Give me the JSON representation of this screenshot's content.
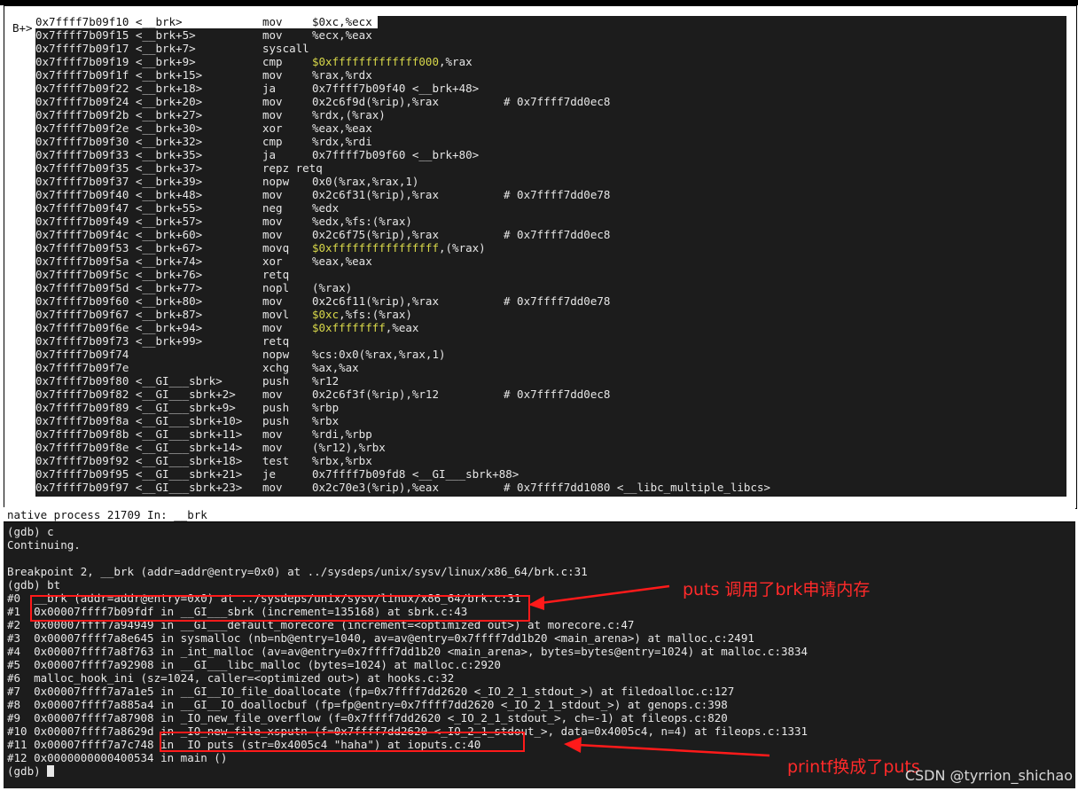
{
  "window": {
    "breakpoint_marker": "B+>",
    "status_line": "native process 21709 In: __brk"
  },
  "asm_lines": [
    {
      "addr": "0x7ffff7b09f10",
      "sym": "<__brk>",
      "op": "mov",
      "args": "$0xc,%ecx",
      "hl": false,
      "comment": ""
    },
    {
      "addr": "0x7ffff7b09f15",
      "sym": "<__brk+5>",
      "op": "mov",
      "args": "%ecx,%eax",
      "hl": false,
      "comment": ""
    },
    {
      "addr": "0x7ffff7b09f17",
      "sym": "<__brk+7>",
      "op": "syscall",
      "args": "",
      "hl": false,
      "comment": ""
    },
    {
      "addr": "0x7ffff7b09f19",
      "sym": "<__brk+9>",
      "op": "cmp",
      "args": "$0xfffffffffffff000",
      "args2": ",%rax",
      "hl": true,
      "comment": ""
    },
    {
      "addr": "0x7ffff7b09f1f",
      "sym": "<__brk+15>",
      "op": "mov",
      "args": "%rax,%rdx",
      "hl": false,
      "comment": ""
    },
    {
      "addr": "0x7ffff7b09f22",
      "sym": "<__brk+18>",
      "op": "ja",
      "args": "0x7ffff7b09f40 <__brk+48>",
      "hl": false,
      "comment": ""
    },
    {
      "addr": "0x7ffff7b09f24",
      "sym": "<__brk+20>",
      "op": "mov",
      "args": "0x2c6f9d(%rip),%rax",
      "hl": false,
      "comment": "# 0x7ffff7dd0ec8"
    },
    {
      "addr": "0x7ffff7b09f2b",
      "sym": "<__brk+27>",
      "op": "mov",
      "args": "%rdx,(%rax)",
      "hl": false,
      "comment": ""
    },
    {
      "addr": "0x7ffff7b09f2e",
      "sym": "<__brk+30>",
      "op": "xor",
      "args": "%eax,%eax",
      "hl": false,
      "comment": ""
    },
    {
      "addr": "0x7ffff7b09f30",
      "sym": "<__brk+32>",
      "op": "cmp",
      "args": "%rdx,%rdi",
      "hl": false,
      "comment": ""
    },
    {
      "addr": "0x7ffff7b09f33",
      "sym": "<__brk+35>",
      "op": "ja",
      "args": "0x7ffff7b09f60 <__brk+80>",
      "hl": false,
      "comment": ""
    },
    {
      "addr": "0x7ffff7b09f35",
      "sym": "<__brk+37>",
      "op": "repz retq",
      "args": "",
      "hl": false,
      "comment": ""
    },
    {
      "addr": "0x7ffff7b09f37",
      "sym": "<__brk+39>",
      "op": "nopw",
      "args": "0x0(%rax,%rax,1)",
      "hl": false,
      "comment": ""
    },
    {
      "addr": "0x7ffff7b09f40",
      "sym": "<__brk+48>",
      "op": "mov",
      "args": "0x2c6f31(%rip),%rax",
      "hl": false,
      "comment": "# 0x7ffff7dd0e78"
    },
    {
      "addr": "0x7ffff7b09f47",
      "sym": "<__brk+55>",
      "op": "neg",
      "args": "%edx",
      "hl": false,
      "comment": ""
    },
    {
      "addr": "0x7ffff7b09f49",
      "sym": "<__brk+57>",
      "op": "mov",
      "args": "%edx,%fs:(%rax)",
      "hl": false,
      "comment": ""
    },
    {
      "addr": "0x7ffff7b09f4c",
      "sym": "<__brk+60>",
      "op": "mov",
      "args": "0x2c6f75(%rip),%rax",
      "hl": false,
      "comment": "# 0x7ffff7dd0ec8"
    },
    {
      "addr": "0x7ffff7b09f53",
      "sym": "<__brk+67>",
      "op": "movq",
      "args": "$0xffffffffffffffff",
      "args2": ",(%rax)",
      "hl": true,
      "comment": ""
    },
    {
      "addr": "0x7ffff7b09f5a",
      "sym": "<__brk+74>",
      "op": "xor",
      "args": "%eax,%eax",
      "hl": false,
      "comment": ""
    },
    {
      "addr": "0x7ffff7b09f5c",
      "sym": "<__brk+76>",
      "op": "retq",
      "args": "",
      "hl": false,
      "comment": ""
    },
    {
      "addr": "0x7ffff7b09f5d",
      "sym": "<__brk+77>",
      "op": "nopl",
      "args": "(%rax)",
      "hl": false,
      "comment": ""
    },
    {
      "addr": "0x7ffff7b09f60",
      "sym": "<__brk+80>",
      "op": "mov",
      "args": "0x2c6f11(%rip),%rax",
      "hl": false,
      "comment": "# 0x7ffff7dd0e78"
    },
    {
      "addr": "0x7ffff7b09f67",
      "sym": "<__brk+87>",
      "op": "movl",
      "args": "$0xc",
      "args2": ",%fs:(%rax)",
      "hl": true,
      "comment": ""
    },
    {
      "addr": "0x7ffff7b09f6e",
      "sym": "<__brk+94>",
      "op": "mov",
      "args": "$0xffffffff",
      "args2": ",%eax",
      "hl": true,
      "comment": ""
    },
    {
      "addr": "0x7ffff7b09f73",
      "sym": "<__brk+99>",
      "op": "retq",
      "args": "",
      "hl": false,
      "comment": ""
    },
    {
      "addr": "0x7ffff7b09f74",
      "sym": "",
      "op": "nopw",
      "args": "%cs:0x0(%rax,%rax,1)",
      "hl": false,
      "comment": ""
    },
    {
      "addr": "0x7ffff7b09f7e",
      "sym": "",
      "op": "xchg",
      "args": "%ax,%ax",
      "hl": false,
      "comment": ""
    },
    {
      "addr": "0x7ffff7b09f80",
      "sym": "<__GI___sbrk>",
      "op": "push",
      "args": "%r12",
      "hl": false,
      "comment": ""
    },
    {
      "addr": "0x7ffff7b09f82",
      "sym": "<__GI___sbrk+2>",
      "op": "mov",
      "args": "0x2c6f3f(%rip),%r12",
      "hl": false,
      "comment": "# 0x7ffff7dd0ec8"
    },
    {
      "addr": "0x7ffff7b09f89",
      "sym": "<__GI___sbrk+9>",
      "op": "push",
      "args": "%rbp",
      "hl": false,
      "comment": ""
    },
    {
      "addr": "0x7ffff7b09f8a",
      "sym": "<__GI___sbrk+10>",
      "op": "push",
      "args": "%rbx",
      "hl": false,
      "comment": ""
    },
    {
      "addr": "0x7ffff7b09f8b",
      "sym": "<__GI___sbrk+11>",
      "op": "mov",
      "args": "%rdi,%rbp",
      "hl": false,
      "comment": ""
    },
    {
      "addr": "0x7ffff7b09f8e",
      "sym": "<__GI___sbrk+14>",
      "op": "mov",
      "args": "(%r12),%rbx",
      "hl": false,
      "comment": ""
    },
    {
      "addr": "0x7ffff7b09f92",
      "sym": "<__GI___sbrk+18>",
      "op": "test",
      "args": "%rbx,%rbx",
      "hl": false,
      "comment": ""
    },
    {
      "addr": "0x7ffff7b09f95",
      "sym": "<__GI___sbrk+21>",
      "op": "je",
      "args": "0x7ffff7b09fd8 <__GI___sbrk+88>",
      "hl": false,
      "comment": ""
    },
    {
      "addr": "0x7ffff7b09f97",
      "sym": "<__GI___sbrk+23>",
      "op": "mov",
      "args": "0x2c70e3(%rip),%eax",
      "hl": false,
      "comment": "# 0x7ffff7dd1080 <__libc_multiple_libcs>"
    }
  ],
  "console_lines": [
    "(gdb) c",
    "Continuing.",
    "",
    "Breakpoint 2, __brk (addr=addr@entry=0x0) at ../sysdeps/unix/sysv/linux/x86_64/brk.c:31",
    "(gdb) bt",
    "#0  __brk (addr=addr@entry=0x0) at ../sysdeps/unix/sysv/linux/x86_64/brk.c:31",
    "#1  0x00007ffff7b09fdf in __GI___sbrk (increment=135168) at sbrk.c:43",
    "#2  0x00007ffff7a94949 in __GI___default_morecore (increment=<optimized out>) at morecore.c:47",
    "#3  0x00007ffff7a8e645 in sysmalloc (nb=nb@entry=1040, av=av@entry=0x7ffff7dd1b20 <main_arena>) at malloc.c:2491",
    "#4  0x00007ffff7a8f763 in _int_malloc (av=av@entry=0x7ffff7dd1b20 <main_arena>, bytes=bytes@entry=1024) at malloc.c:3834",
    "#5  0x00007ffff7a92908 in __GI___libc_malloc (bytes=1024) at malloc.c:2920",
    "#6  malloc_hook_ini (sz=1024, caller=<optimized out>) at hooks.c:32",
    "#7  0x00007ffff7a7a1e5 in __GI__IO_file_doallocate (fp=0x7ffff7dd2620 <_IO_2_1_stdout_>) at filedoalloc.c:127",
    "#8  0x00007ffff7a885a4 in __GI__IO_doallocbuf (fp=fp@entry=0x7ffff7dd2620 <_IO_2_1_stdout_>) at genops.c:398",
    "#9  0x00007ffff7a87908 in _IO_new_file_overflow (f=0x7ffff7dd2620 <_IO_2_1_stdout_>, ch=-1) at fileops.c:820",
    "#10 0x00007ffff7a8629d in _IO_new_file_xsputn (f=0x7ffff7dd2620 <_IO_2_1_stdout_>, data=0x4005c4, n=4) at fileops.c:1331",
    "#11 0x00007ffff7a7c748 in _IO_puts (str=0x4005c4 \"haha\") at ioputs.c:40",
    "#12 0x0000000000400534 in main ()",
    "(gdb) "
  ],
  "annotations": {
    "puts_brk": "puts 调用了brk申请内存",
    "printf_puts": "printf换成了puts"
  },
  "watermark": "CSDN @tyrrion_shichao",
  "colors": {
    "terminal_bg": "#1c1c1c",
    "text": "#e6e6e6",
    "highlight_constant": "#d8d84a",
    "annotation_red": "#ff1a1a"
  }
}
